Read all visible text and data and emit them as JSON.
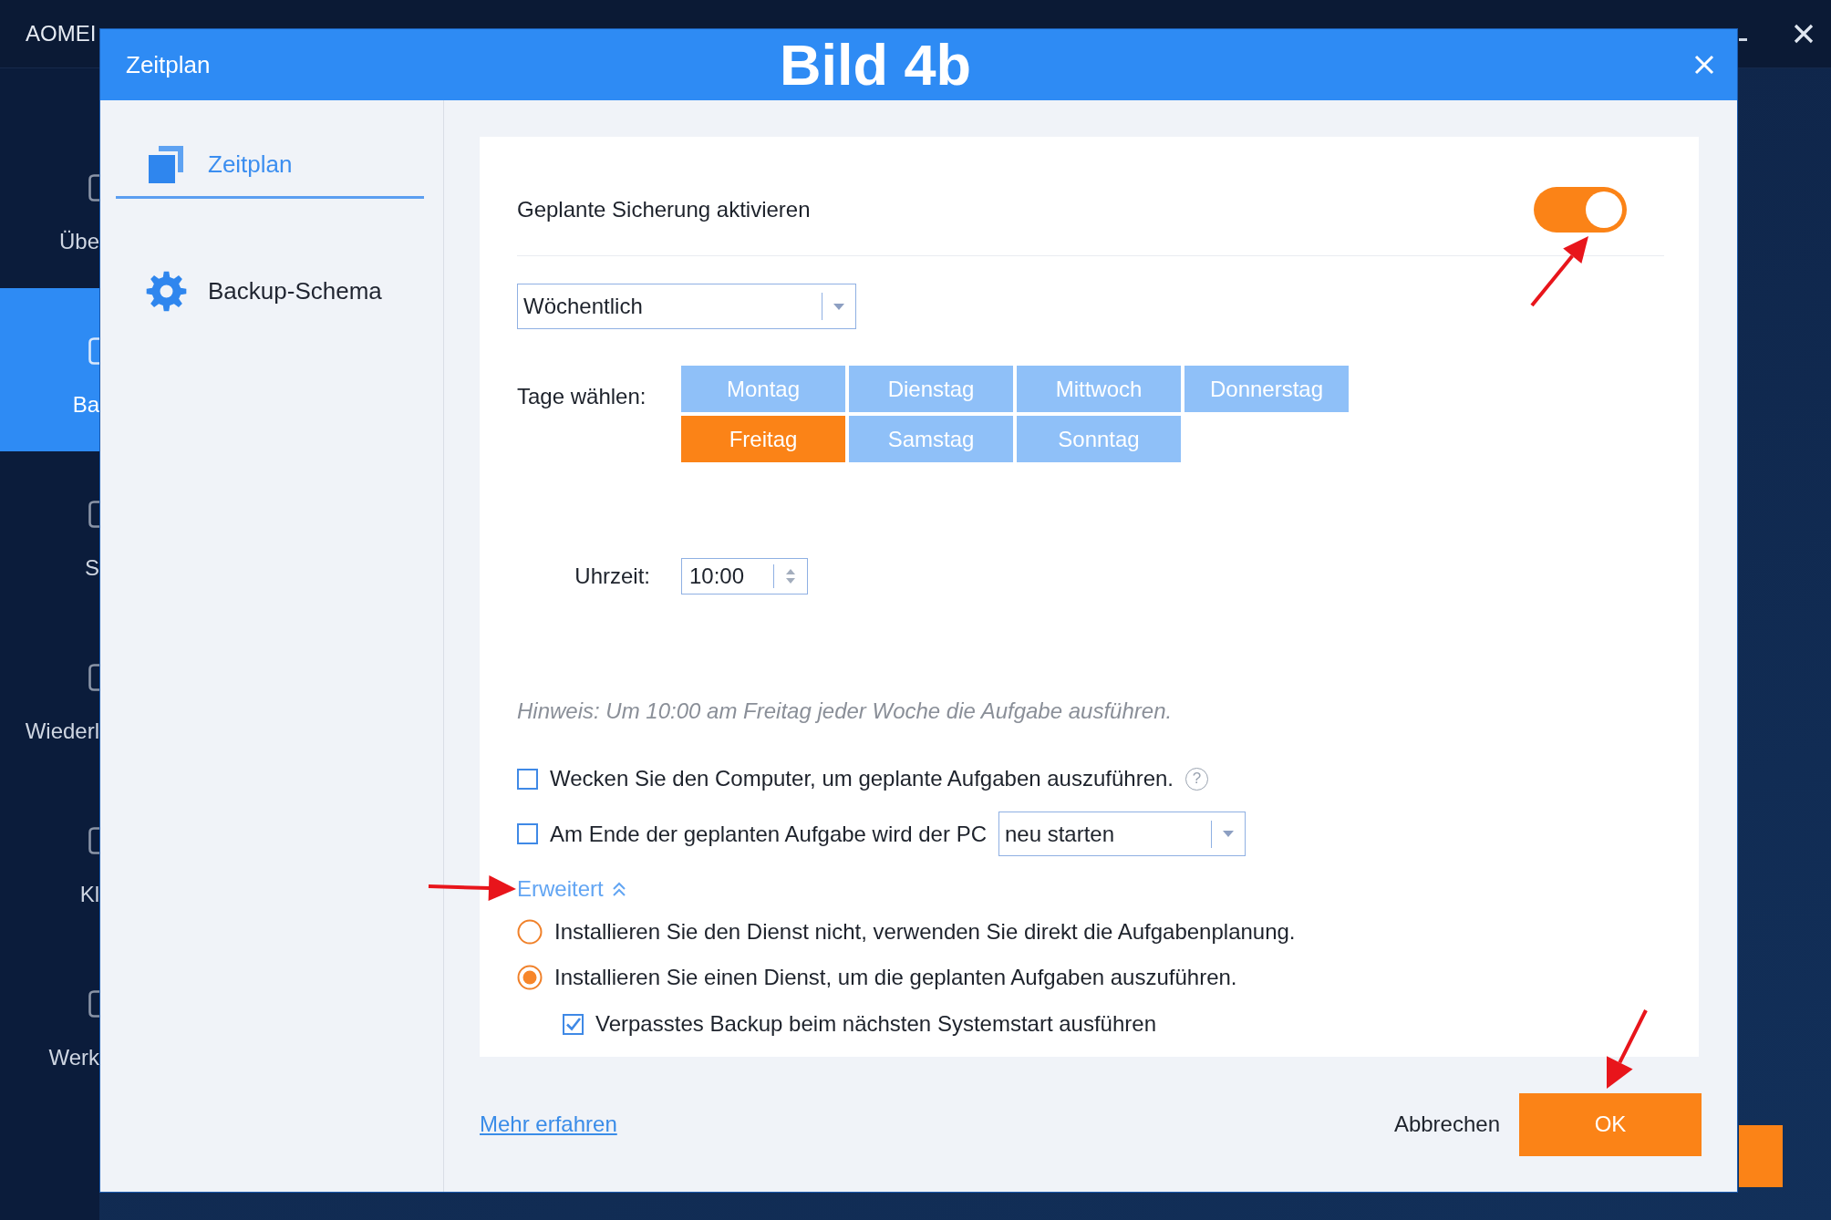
{
  "app": {
    "title": "AOMEI",
    "sidebar": [
      {
        "label": "Übe",
        "selected": false
      },
      {
        "label": "Ba",
        "selected": true
      },
      {
        "label": "S",
        "selected": false
      },
      {
        "label": "Wiederl",
        "selected": false
      },
      {
        "label": "Kl",
        "selected": false
      },
      {
        "label": "Werk",
        "selected": false
      }
    ]
  },
  "dialog": {
    "title": "Zeitplan",
    "figure_label": "Bild 4b",
    "nav_items": [
      {
        "kind": "schedule",
        "label": "Zeitplan",
        "selected": true
      },
      {
        "kind": "scheme",
        "label": "Backup-Schema",
        "selected": false
      }
    ],
    "enable": {
      "label": "Geplante Sicherung aktivieren",
      "on": true
    },
    "frequency": {
      "value": "Wöchentlich"
    },
    "days": {
      "label": "Tage wählen:",
      "items": [
        {
          "label": "Montag",
          "selected": false
        },
        {
          "label": "Dienstag",
          "selected": false
        },
        {
          "label": "Mittwoch",
          "selected": false
        },
        {
          "label": "Donnerstag",
          "selected": false
        },
        {
          "label": "Freitag",
          "selected": true
        },
        {
          "label": "Samstag",
          "selected": false
        },
        {
          "label": "Sonntag",
          "selected": false
        }
      ]
    },
    "time": {
      "label": "Uhrzeit:",
      "value": "10:00"
    },
    "hint": "Hinweis: Um 10:00 am Freitag jeder Woche die Aufgabe ausführen.",
    "wake": {
      "label": "Wecken Sie den Computer, um geplante Aufgaben auszuführen.",
      "checked": false,
      "help": "?"
    },
    "end_action": {
      "label": "Am Ende der geplanten Aufgabe wird der PC",
      "checked": false,
      "value": "neu starten"
    },
    "advanced": {
      "label": "Erweitert",
      "expanded": true,
      "service_options": [
        {
          "label": "Installieren Sie den Dienst nicht, verwenden Sie direkt die Aufgabenplanung.",
          "selected": false
        },
        {
          "label": "Installieren Sie einen Dienst, um die geplanten Aufgaben auszuführen.",
          "selected": true
        }
      ],
      "missed_backup": {
        "label": "Verpasstes Backup beim nächsten Systemstart ausführen",
        "checked": true
      }
    },
    "footer": {
      "link": "Mehr erfahren",
      "cancel": "Abbrechen",
      "ok": "OK"
    }
  }
}
